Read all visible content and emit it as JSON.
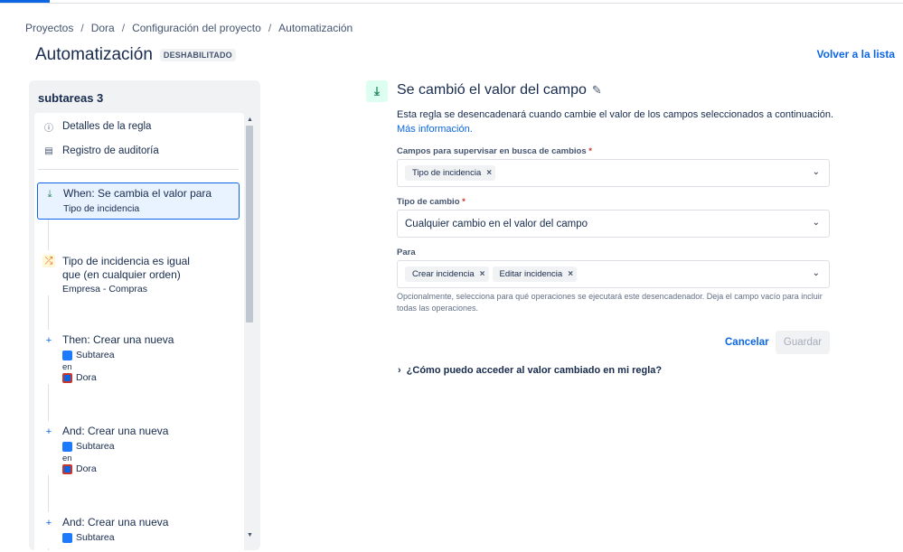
{
  "breadcrumb": [
    "Proyectos",
    "Dora",
    "Configuración del proyecto",
    "Automatización"
  ],
  "page": {
    "title": "Automatización",
    "status_badge": "DESHABILITADO",
    "back_link": "Volver a la lista"
  },
  "rule": {
    "name": "subtareas 3",
    "menu": [
      {
        "label": "Detalles de la regla",
        "icon": "info-icon"
      },
      {
        "label": "Registro de auditoría",
        "icon": "clipboard-icon"
      }
    ],
    "steps": [
      {
        "title": "When: Se cambia el valor para",
        "sub": "Tipo de incidencia",
        "icon": "trigger-icon"
      },
      {
        "title_line1": "Tipo de incidencia es igual",
        "title_line2": "que (en cualquier orden)",
        "sub": "Empresa - Compras",
        "icon": "shuffle-icon"
      },
      {
        "title": "Then: Crear una nueva",
        "issue_type": "Subtarea",
        "connector": "en",
        "project": "Dora",
        "icon": "plus-icon"
      },
      {
        "title": "And: Crear una nueva",
        "issue_type": "Subtarea",
        "connector": "en",
        "project": "Dora",
        "icon": "plus-icon"
      },
      {
        "title": "And: Crear una nueva",
        "issue_type": "Subtarea",
        "icon": "plus-icon"
      }
    ]
  },
  "trigger": {
    "title": "Se cambió el valor del campo",
    "description": "Esta regla se desencadenará cuando cambie el valor de los campos seleccionados a continuación.",
    "more_info": "Más información.",
    "fields_label": "Campos para supervisar en busca de cambios",
    "fields_tags": [
      "Tipo de incidencia"
    ],
    "change_type_label": "Tipo de cambio",
    "change_type_value": "Cualquier cambio en el valor del campo",
    "for_label": "Para",
    "for_tags": [
      "Crear incidencia",
      "Editar incidencia"
    ],
    "help": "Opcionalmente, selecciona para qué operaciones se ejecutará este desencadenador. Deja el campo vacío para incluir todas las operaciones.",
    "required_mark": "*",
    "cancel": "Cancelar",
    "save": "Guardar",
    "faq": "¿Cómo puedo acceder al valor cambiado en mi regla?"
  }
}
